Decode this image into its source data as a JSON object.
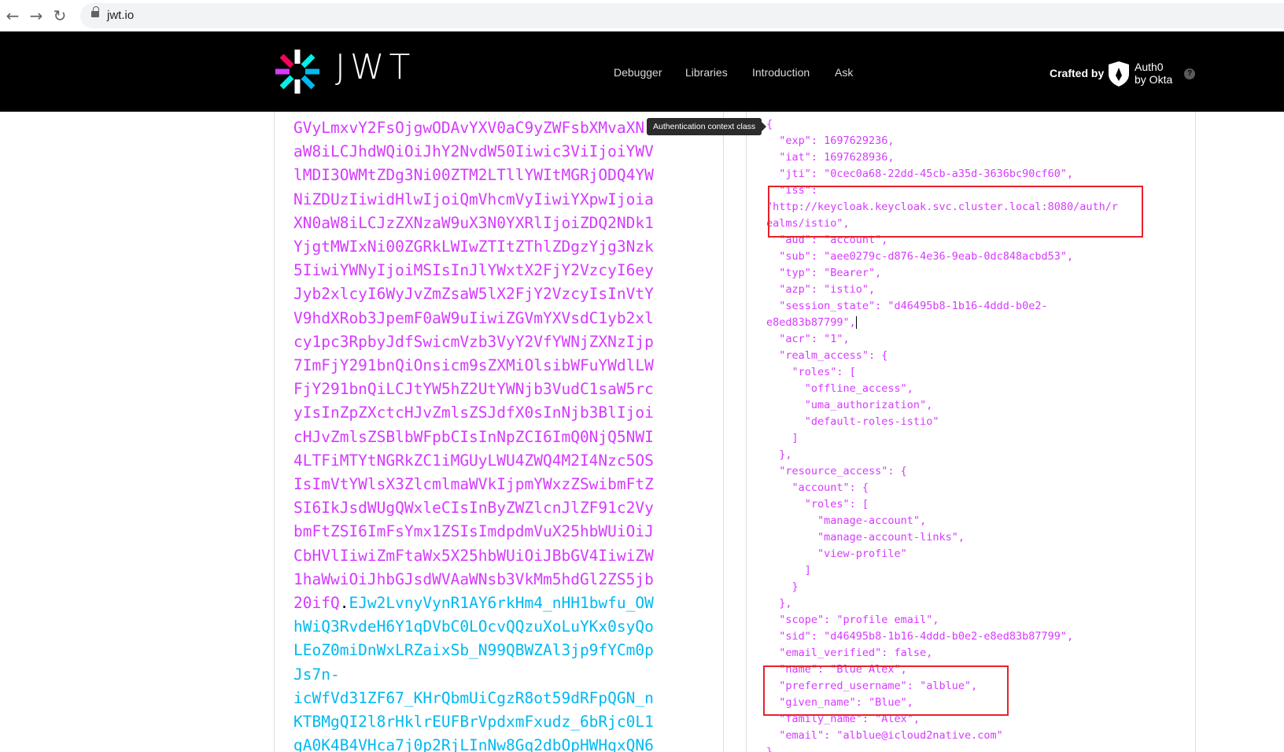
{
  "browser": {
    "back_icon": "←",
    "forward_icon": "→",
    "reload_icon": "↻",
    "url": "jwt.io"
  },
  "header": {
    "wordmark": "JWT",
    "nav": [
      "Debugger",
      "Libraries",
      "Introduction",
      "Ask"
    ],
    "crafted_by": "Crafted by",
    "brand_line1": "Auth0",
    "brand_line2": "by Okta",
    "help": "?"
  },
  "tooltip": "Authentication context class",
  "encoded_token": {
    "payload_lines": [
      "GVyLmxvY2FsOjgwODAvYXV0aC9yZWFsbXMvaXN",
      "aW8iLCJhdWQiOiJhY2NvdW50Iiwic3ViIjoiYWV",
      "lMDI3OWMtZDg3Ni00ZTM2LTllYWItMGRjODQ4YW",
      "NiZDUzIiwidHlwIjoiQmVhcmVyIiwiYXpwIjoia",
      "XN0aW8iLCJzZXNzaW9uX3N0YXRlIjoiZDQ2NDk1",
      "YjgtMWIxNi00ZGRkLWIwZTItZThlZDgzYjg3Nzk",
      "5IiwiYWNyIjoiMSIsInJlYWxtX2FjY2VzcyI6ey",
      "Jyb2xlcyI6WyJvZmZsaW5lX2FjY2VzcyIsInVtY",
      "V9hdXRob3JpemF0aW9uIiwiZGVmYXVsdC1yb2xl",
      "cy1pc3RpbyJdfSwicmVzb3VyY2VfYWNjZXNzIjp",
      "7ImFjY291bnQiOnsicm9sZXMiOlsibWFuYWdlLW",
      "FjY291bnQiLCJtYW5hZ2UtYWNjb3VudC1saW5rc",
      "yIsInZpZXctcHJvZmlsZSJdfX0sInNjb3BlIjoi",
      "cHJvZmlsZSBlbWFpbCIsInNpZCI6ImQ0NjQ5NWI",
      "4LTFiMTYtNGRkZC1iMGUyLWU4ZWQ4M2I4Nzc5OS",
      "IsImVtYWlsX3ZlcmlmaWVkIjpmYWxzZSwibmFtZ",
      "SI6IkJsdWUgQWxleCIsInByZWZlcnJlZF91c2Vy",
      "bmFtZSI6ImFsYmx1ZSIsImdpdmVuX25hbWUiOiJ",
      "CbHVlIiwiZmFtaWx5X25hbWUiOiJBbGV4IiwiZW",
      "1haWwiOiJhbGJsdWVAaWNsb3VkMm5hdGl2ZS5jb",
      "20ifQ"
    ],
    "dot": ".",
    "sig_first": "EJw2LvnyVynR1AY6rkHm4_nHH1bwfu_OW",
    "sig_lines": [
      "hWiQ3RvdeH6Y1qDVbC0LOcvQQzuXoLuYKx0syQo",
      "LEoZ0miDnWxLRZaixSb_N99QBWZAl3jp9fYCm0p",
      "Js7n-",
      "icWfVd31ZF67_KHrQbmUiCgzR8ot59dRFpQGN_n",
      "KTBMgQI2l8rHklrEUFBrVpdxmFxudz_6bRjc0L1",
      "gA0K4B4VHca7j0p2RjLInNw8Gq2dbOpHWHqxQN6"
    ]
  },
  "decoded_payload": {
    "lines": [
      "{",
      "  \"exp\": 1697629236,",
      "  \"iat\": 1697628936,",
      "  \"jti\": \"0cec0a68-22dd-45cb-a35d-3636bc90cf60\",",
      "  \"iss\":",
      "\"http://keycloak.keycloak.svc.cluster.local:8080/auth/r",
      "ealms/istio\",",
      "  \"aud\": \"account\",",
      "  \"sub\": \"aee0279c-d876-4e36-9eab-0dc848acbd53\",",
      "  \"typ\": \"Bearer\",",
      "  \"azp\": \"istio\",",
      "  \"session_state\": \"d46495b8-1b16-4ddd-b0e2-",
      "e8ed83b87799\",",
      "  \"acr\": \"1\",",
      "  \"realm_access\": {",
      "    \"roles\": [",
      "      \"offline_access\",",
      "      \"uma_authorization\",",
      "      \"default-roles-istio\"",
      "    ]",
      "  },",
      "  \"resource_access\": {",
      "    \"account\": {",
      "      \"roles\": [",
      "        \"manage-account\",",
      "        \"manage-account-links\",",
      "        \"view-profile\"",
      "      ]",
      "    }",
      "  },",
      "  \"scope\": \"profile email\",",
      "  \"sid\": \"d46495b8-1b16-4ddd-b0e2-e8ed83b87799\",",
      "  \"email_verified\": false,",
      "  \"name\": \"Blue Alex\",",
      "  \"preferred_username\": \"alblue\",",
      "  \"given_name\": \"Blue\",",
      "  \"family_name\": \"Alex\",",
      "  \"email\": \"alblue@icloud2native.com\"",
      "}"
    ]
  },
  "colors": {
    "payload": "#d63aff",
    "signature": "#00b9f1",
    "highlight_box": "#e8212b",
    "header_bg": "#000000"
  }
}
